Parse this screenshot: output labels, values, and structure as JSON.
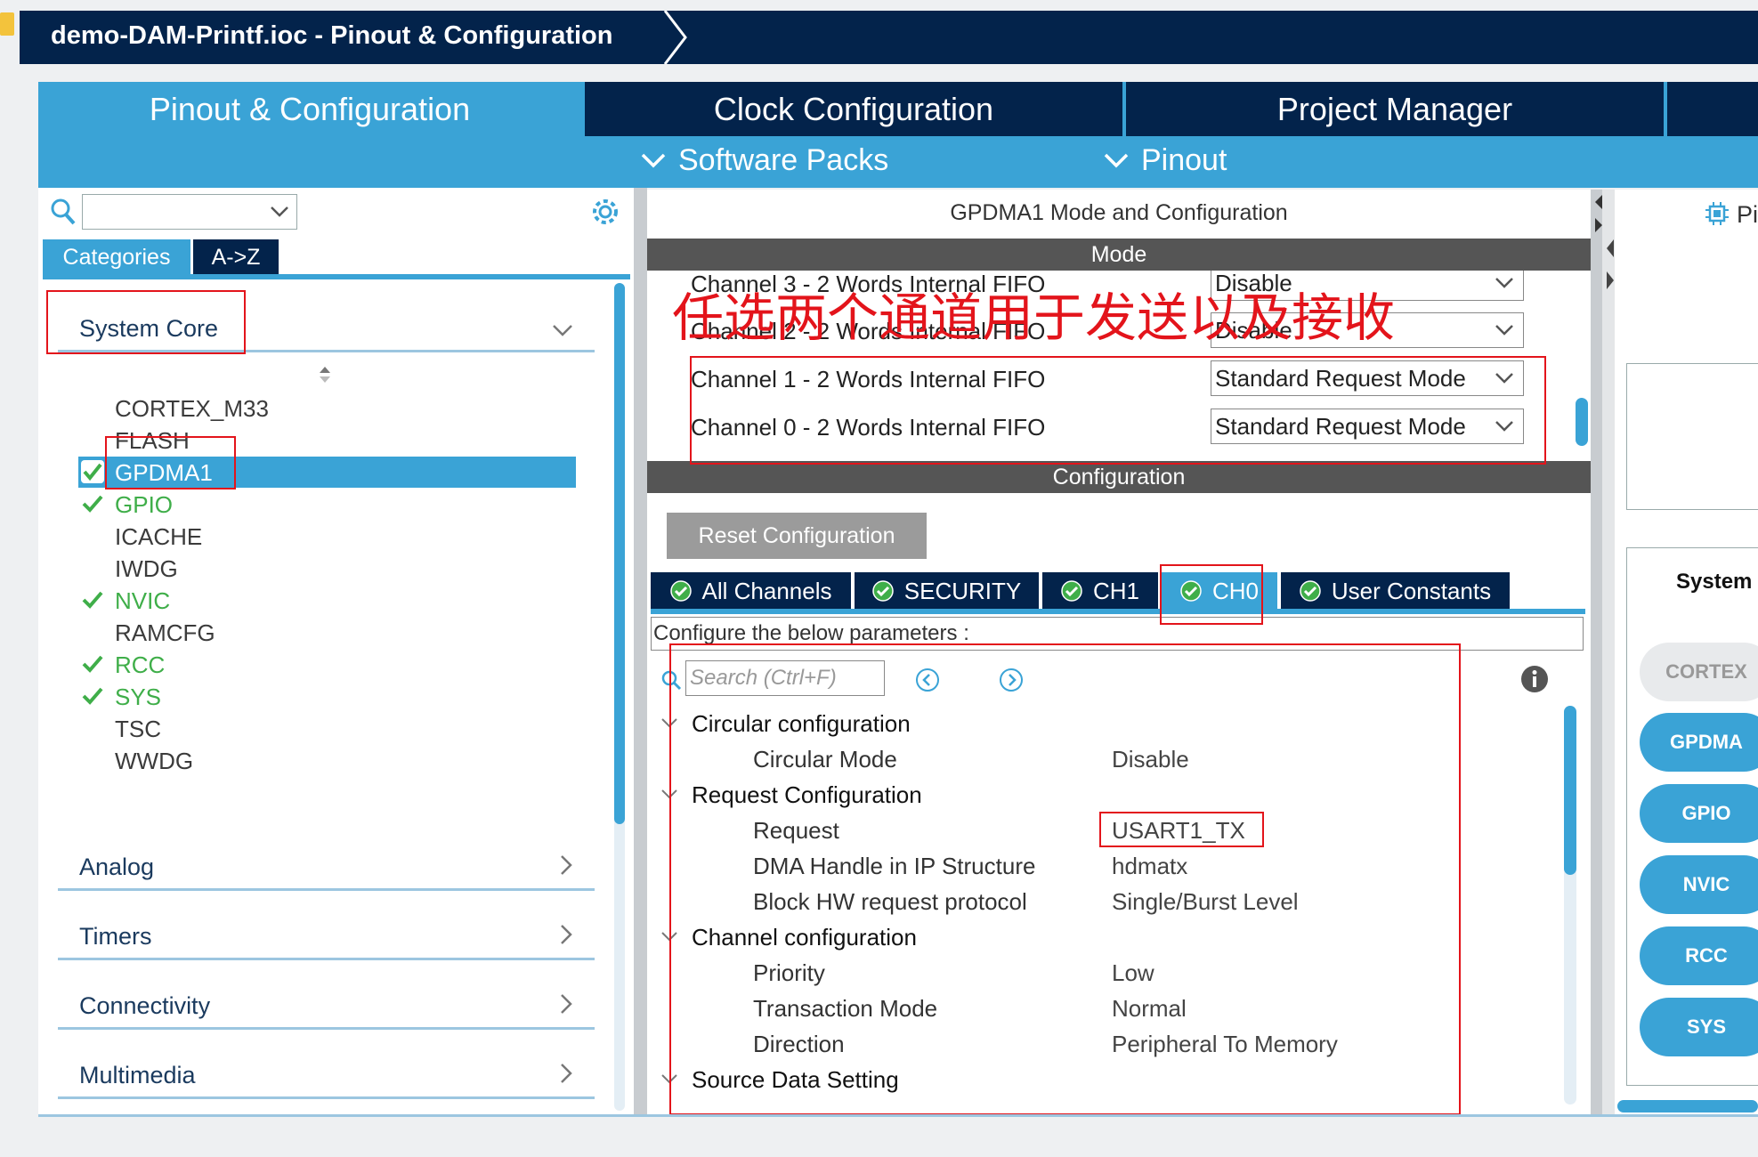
{
  "window": {
    "title": "demo-DAM-Printf.ioc - Pinout & Configuration"
  },
  "main_tabs": [
    {
      "label": "Pinout & Configuration"
    },
    {
      "label": "Clock Configuration"
    },
    {
      "label": "Project Manager"
    }
  ],
  "sub_tabs": [
    {
      "label": "Software Packs"
    },
    {
      "label": "Pinout"
    }
  ],
  "left": {
    "search": {
      "value": ""
    },
    "tabs": [
      {
        "label": "Categories"
      },
      {
        "label": "A->Z"
      }
    ],
    "selected_category": "System Core",
    "system_core_items": [
      {
        "label": "CORTEX_M33",
        "enabled": false
      },
      {
        "label": "FLASH",
        "enabled": false
      },
      {
        "label": "GPDMA1",
        "enabled": true,
        "selected": true
      },
      {
        "label": "GPIO",
        "enabled": true
      },
      {
        "label": "ICACHE",
        "enabled": false
      },
      {
        "label": "IWDG",
        "enabled": false
      },
      {
        "label": "NVIC",
        "enabled": true
      },
      {
        "label": "RAMCFG",
        "enabled": false
      },
      {
        "label": "RCC",
        "enabled": true
      },
      {
        "label": "SYS",
        "enabled": true
      },
      {
        "label": "TSC",
        "enabled": false
      },
      {
        "label": "WWDG",
        "enabled": false
      }
    ],
    "categories": [
      {
        "label": "Analog"
      },
      {
        "label": "Timers"
      },
      {
        "label": "Connectivity"
      },
      {
        "label": "Multimedia"
      }
    ]
  },
  "middle": {
    "title": "GPDMA1 Mode and Configuration",
    "mode_header": "Mode",
    "channels": [
      {
        "label": "Channel 3 - 2 Words Internal FIFO",
        "value": "Disable"
      },
      {
        "label": "Channel 2 - 2 Words Internal FIFO",
        "value": "Disable"
      },
      {
        "label": "Channel 1 - 2 Words Internal FIFO",
        "value": "Standard Request Mode"
      },
      {
        "label": "Channel 0 - 2 Words Internal FIFO",
        "value": "Standard Request Mode"
      }
    ],
    "annotation": "任选两个通道用于发送以及接收",
    "config_header": "Configuration",
    "reset_button": "Reset Configuration",
    "config_tabs": [
      {
        "label": "All Channels"
      },
      {
        "label": "SECURITY"
      },
      {
        "label": "CH1"
      },
      {
        "label": "CH0",
        "active": true
      },
      {
        "label": "User Constants"
      }
    ],
    "configure_text": "Configure the below parameters :",
    "search_placeholder": "Search (Ctrl+F)",
    "groups": [
      {
        "label": "Circular configuration",
        "params": [
          {
            "name": "Circular Mode",
            "value": "Disable"
          }
        ]
      },
      {
        "label": "Request Configuration",
        "params": [
          {
            "name": "Request",
            "value": "USART1_TX"
          },
          {
            "name": "DMA Handle in IP Structure",
            "value": "hdmatx"
          },
          {
            "name": "Block HW request protocol",
            "value": "Single/Burst Level"
          }
        ]
      },
      {
        "label": "Channel configuration",
        "params": [
          {
            "name": "Priority",
            "value": "Low"
          },
          {
            "name": "Transaction Mode",
            "value": "Normal"
          },
          {
            "name": "Direction",
            "value": "Peripheral To Memory"
          }
        ]
      },
      {
        "label": "Source Data Setting",
        "params": []
      }
    ]
  },
  "right": {
    "header_partial": "Pi",
    "system_label": "System",
    "buttons": [
      {
        "label": "CORTEX",
        "enabled": false
      },
      {
        "label": "GPDMA",
        "enabled": true
      },
      {
        "label": "GPIO",
        "enabled": true
      },
      {
        "label": "NVIC",
        "enabled": true
      },
      {
        "label": "RCC",
        "enabled": true
      },
      {
        "label": "SYS",
        "enabled": true
      }
    ]
  },
  "colors": {
    "navy": "#03234b",
    "accent_blue": "#3aa3d6",
    "enabled_green": "#3fae49",
    "annotation_red": "#e3141b",
    "dark_header": "#555555"
  }
}
